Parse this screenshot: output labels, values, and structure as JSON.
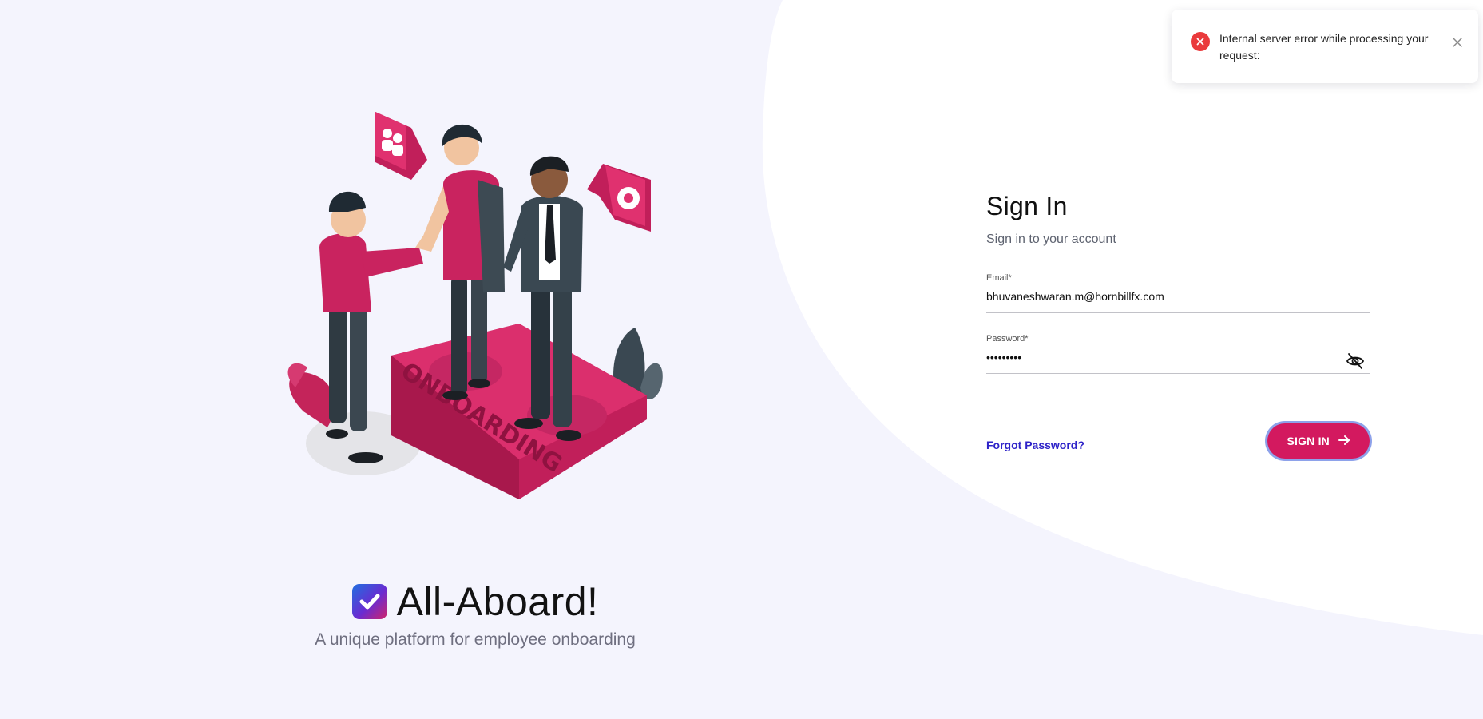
{
  "brand": {
    "name": "All-Aboard!",
    "tagline": "A unique platform for employee onboarding"
  },
  "illustration": {
    "platform_text": "ONBOARDING"
  },
  "signin": {
    "title": "Sign In",
    "subtitle": "Sign in to your account",
    "email": {
      "label": "Email*",
      "value": "bhuvaneshwaran.m@hornbillfx.com"
    },
    "password": {
      "label": "Password*",
      "value": "123456789"
    },
    "forgot_label": "Forgot Password?",
    "submit_label": "SIGN IN"
  },
  "toast": {
    "message": "Internal server error while processing your request:"
  },
  "icons": {
    "toast": "error-icon",
    "close": "close-icon",
    "eye": "eye-off-icon",
    "arrow": "arrow-right-icon"
  },
  "colors": {
    "accent": "#d3195f",
    "link": "#2d22c8",
    "error": "#ea3a3c",
    "background": "#f4f4fd"
  }
}
